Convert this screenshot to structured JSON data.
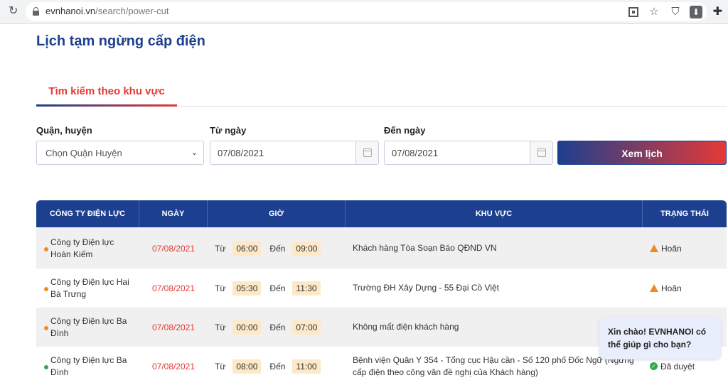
{
  "browser": {
    "url_host": "evnhanoi.vn",
    "url_path": "/search/power-cut"
  },
  "page": {
    "title": "Lịch tạm ngừng cấp điện",
    "tab_label": "Tìm kiếm theo khu vực"
  },
  "form": {
    "district_label": "Quận, huyện",
    "district_value": "Chọn Quận Huyện",
    "from_label": "Từ ngày",
    "from_value": "07/08/2021",
    "to_label": "Đến ngày",
    "to_value": "07/08/2021",
    "submit_label": "Xem lịch"
  },
  "table": {
    "headers": [
      "CÔNG TY ĐIỆN LỰC",
      "NGÀY",
      "GIỜ",
      "KHU VỰC",
      "TRẠNG THÁI"
    ],
    "from_word": "Từ",
    "to_word": "Đến",
    "rows": [
      {
        "company": "Công ty Điện lực Hoàn Kiếm",
        "date": "07/08/2021",
        "start": "06:00",
        "end": "09:00",
        "area": "Khách hàng Tòa Soạn Báo QĐND VN",
        "status": "Hoãn",
        "dot_color": "#f08c1f"
      },
      {
        "company": "Công ty Điện lực Hai Bà Trưng",
        "date": "07/08/2021",
        "start": "05:30",
        "end": "11:30",
        "area": "Trường ĐH Xây Dựng - 55 Đại Cồ Việt",
        "status": "Hoãn",
        "dot_color": "#f08c1f"
      },
      {
        "company": "Công ty Điện lực Ba Đình",
        "date": "07/08/2021",
        "start": "00:00",
        "end": "07:00",
        "area": "Không mất điện khách hàng",
        "status": "",
        "dot_color": "#f08c1f"
      },
      {
        "company": "Công ty Điện lực Ba Đình",
        "date": "07/08/2021",
        "start": "08:00",
        "end": "11:00",
        "area": "Bệnh viện Quân Y 354 - Tổng cục Hậu cần - Số 120 phố Đốc Ngữ (Ngừng cấp điện theo công văn đề nghị của Khách hàng)",
        "status": "Đã duyệt",
        "dot_color": "#2fa84f"
      }
    ]
  },
  "chat": {
    "message": "Xin chào! EVNHANOI có thể giúp gì cho bạn?"
  },
  "colors": {
    "primary": "#1d3f8f",
    "accent": "#e53935",
    "time_bg": "#fde8c8"
  }
}
